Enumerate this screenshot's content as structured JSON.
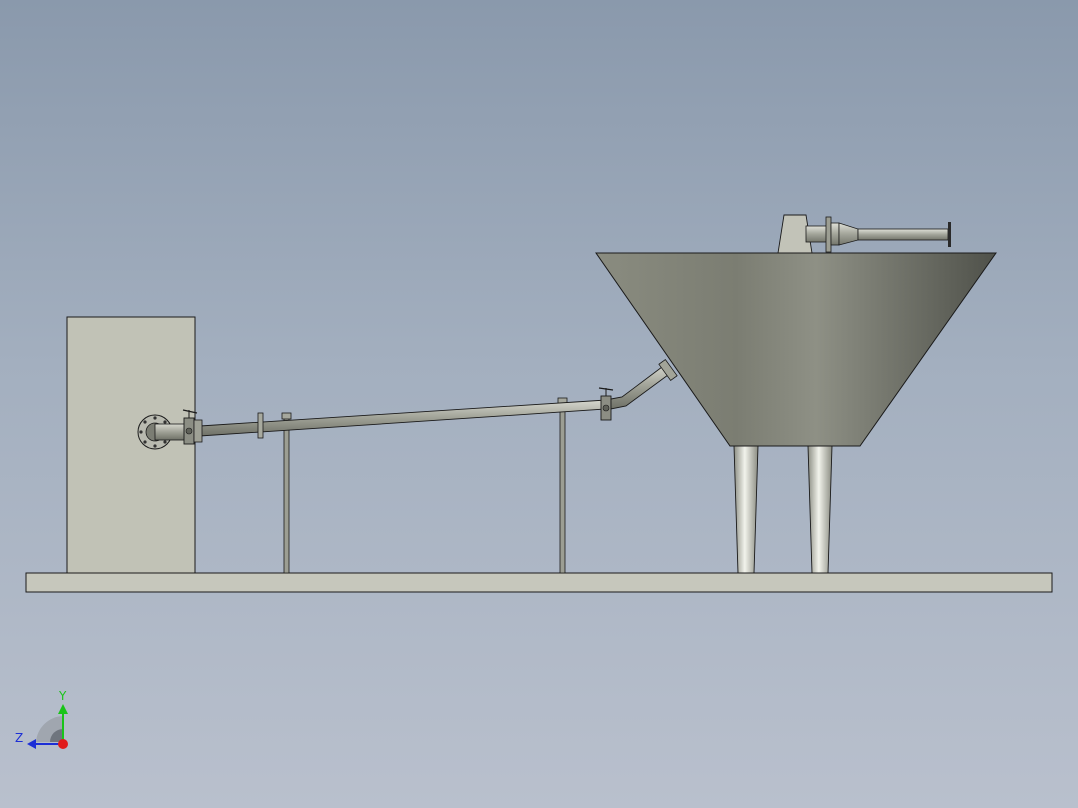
{
  "viewport": {
    "background_top": "#8a99ac",
    "background_bottom": "#b9c0cd"
  },
  "model": {
    "parts": [
      "base-plate",
      "cabinet-box",
      "inlet-flange",
      "inlet-valve",
      "sloped-pipe",
      "pipe-flange",
      "pipe-support-1",
      "pipe-support-2",
      "outlet-valve",
      "elbow-pipe",
      "conical-hopper",
      "hopper-leg-1",
      "hopper-leg-2",
      "top-mount-block",
      "top-nozzle"
    ],
    "colors": {
      "steel": "#8f9288",
      "cabinet": "#c1c2b6",
      "plate": "#c6c7bc",
      "hopper_light": "#898b80",
      "hopper_dark": "#55574f",
      "outline": "#1a1a1a"
    }
  },
  "triad": {
    "y_label": "Y",
    "z_label": "Z",
    "y_color": "#19c419",
    "z_color": "#1d2fd6",
    "x_color": "#e01b1b"
  }
}
